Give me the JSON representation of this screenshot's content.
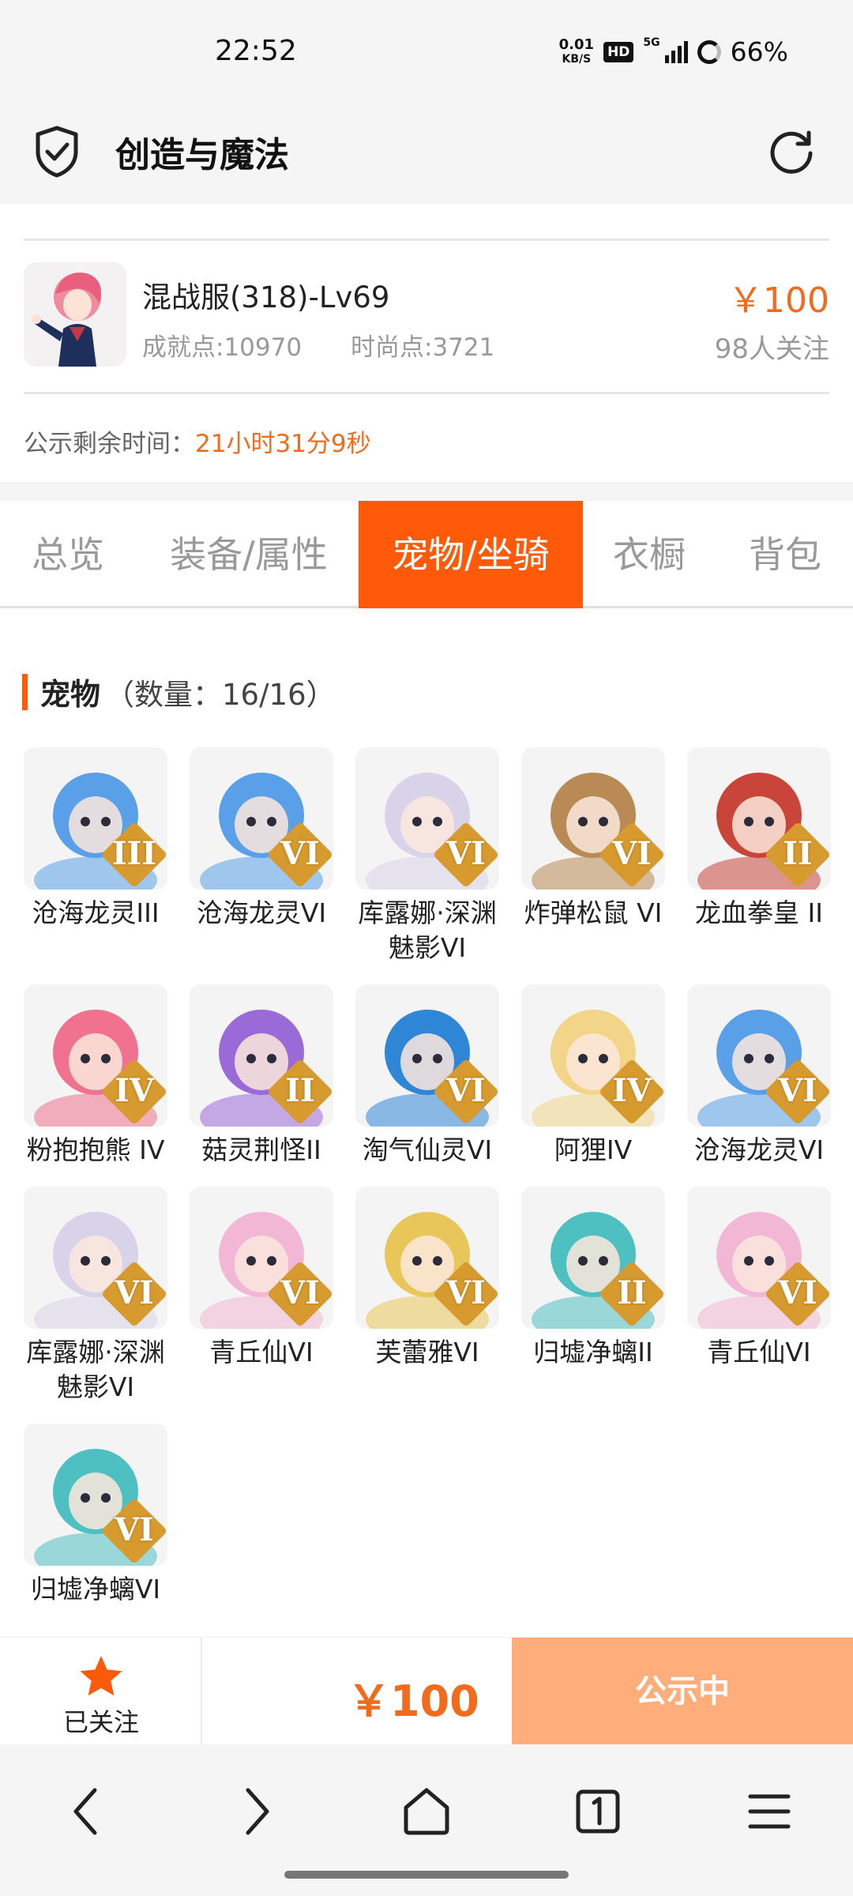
{
  "status_bar": {
    "time": "22:52",
    "net_speed_value": "0.01",
    "net_speed_unit": "KB/S",
    "hd": "HD",
    "network": "5G",
    "battery": "66%"
  },
  "header": {
    "title": "创造与魔法",
    "shield_icon": "shield-check-icon",
    "refresh_icon": "refresh-icon"
  },
  "product": {
    "name": "混战服(318)-Lv69",
    "price": "￥100",
    "achievement": "成就点:10970",
    "fashion": "时尚点:3721",
    "followers": "98人关注"
  },
  "countdown": {
    "label": "公示剩余时间：",
    "value": "21小时31分9秒"
  },
  "tabs": [
    {
      "label": "总览",
      "active": false
    },
    {
      "label": "装备/属性",
      "active": false
    },
    {
      "label": "宠物/坐骑",
      "active": true
    },
    {
      "label": "衣橱",
      "active": false
    },
    {
      "label": "背包",
      "active": false
    }
  ],
  "section": {
    "title": "宠物",
    "count": "（数量：16/16）"
  },
  "pets": [
    {
      "name": "沧海龙灵III",
      "grade": "III",
      "color": "#5aa0e8"
    },
    {
      "name": "沧海龙灵VI",
      "grade": "VI",
      "color": "#5aa0e8"
    },
    {
      "name": "库露娜·深渊魅影VI",
      "grade": "VI",
      "color": "#d9d3ea"
    },
    {
      "name": "炸弹松鼠 VI",
      "grade": "VI",
      "color": "#b98a55"
    },
    {
      "name": "龙血拳皇 II",
      "grade": "II",
      "color": "#c9453a"
    },
    {
      "name": "粉抱抱熊 IV",
      "grade": "IV",
      "color": "#f0728f"
    },
    {
      "name": "菇灵荆怪II",
      "grade": "II",
      "color": "#9a6ad8"
    },
    {
      "name": "淘气仙灵VI",
      "grade": "VI",
      "color": "#2f86d6"
    },
    {
      "name": "阿狸IV",
      "grade": "IV",
      "color": "#f3d58a"
    },
    {
      "name": "沧海龙灵VI",
      "grade": "VI",
      "color": "#5aa0e8"
    },
    {
      "name": "库露娜·深渊魅影VI",
      "grade": "VI",
      "color": "#d9d3ea"
    },
    {
      "name": "青丘仙VI",
      "grade": "VI",
      "color": "#f2b7d4"
    },
    {
      "name": "芙蕾雅VI",
      "grade": "VI",
      "color": "#e9c65a"
    },
    {
      "name": "归墟净螭II",
      "grade": "II",
      "color": "#4fc0c2"
    },
    {
      "name": "青丘仙VI",
      "grade": "VI",
      "color": "#f2b7d4"
    },
    {
      "name": "归墟净螭VI",
      "grade": "VI",
      "color": "#4fc0c2"
    }
  ],
  "bottom": {
    "follow_label": "已关注",
    "follow_icon": "star-icon",
    "price": "￥100",
    "status_button": "公示中"
  },
  "colors": {
    "accent": "#ff5a0a",
    "price": "#f26b1d",
    "status_button": "#ffae7b"
  }
}
